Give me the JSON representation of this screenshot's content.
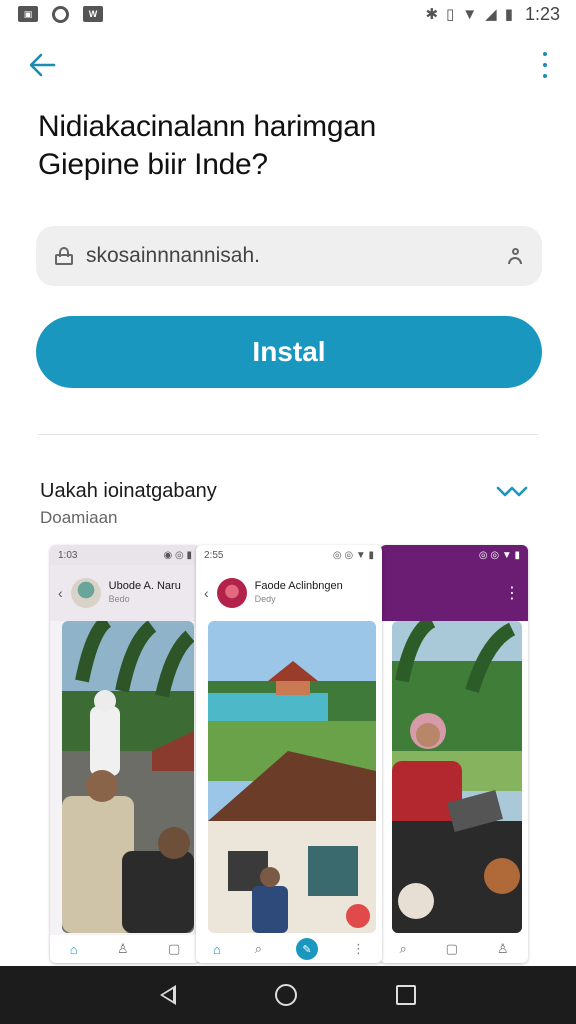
{
  "status_bar": {
    "time": "1:23",
    "left_icons": [
      "photo-notification-icon",
      "sync-notification-icon",
      "w-notification-icon"
    ],
    "right_icons": [
      "bluetooth-icon",
      "vibrate-icon",
      "wifi-icon",
      "signal-icon",
      "battery-icon"
    ]
  },
  "app_bar": {
    "back_icon": "arrow-left-icon",
    "menu_icon": "more-vert-icon",
    "accent": "#1a8db0"
  },
  "headline": {
    "line1": "Nidiakacinalann harimgan",
    "line2": "Giepine biir Inde?"
  },
  "search": {
    "value": "skosainnnannisah."
  },
  "install_button": {
    "label": "Instal",
    "color": "#1a97bf"
  },
  "section": {
    "title": "Uakah ioinatgabany",
    "subtitle": "Doamiaan"
  },
  "screenshots": [
    {
      "status_time": "1:03",
      "title": "Ubode A. Naru",
      "subtitle": "Bedo",
      "nav_icons": [
        "home-icon",
        "person-icon",
        "chat-icon"
      ]
    },
    {
      "status_time": "2:55",
      "title": "Faode Aclinbngen",
      "subtitle": "Dedy",
      "nav_icons": [
        "home-icon",
        "search-icon",
        "chat-icon"
      ]
    },
    {
      "status_time": "",
      "title": "",
      "subtitle": "",
      "nav_icons": [
        "search-icon",
        "add-icon",
        "person-icon"
      ]
    }
  ]
}
